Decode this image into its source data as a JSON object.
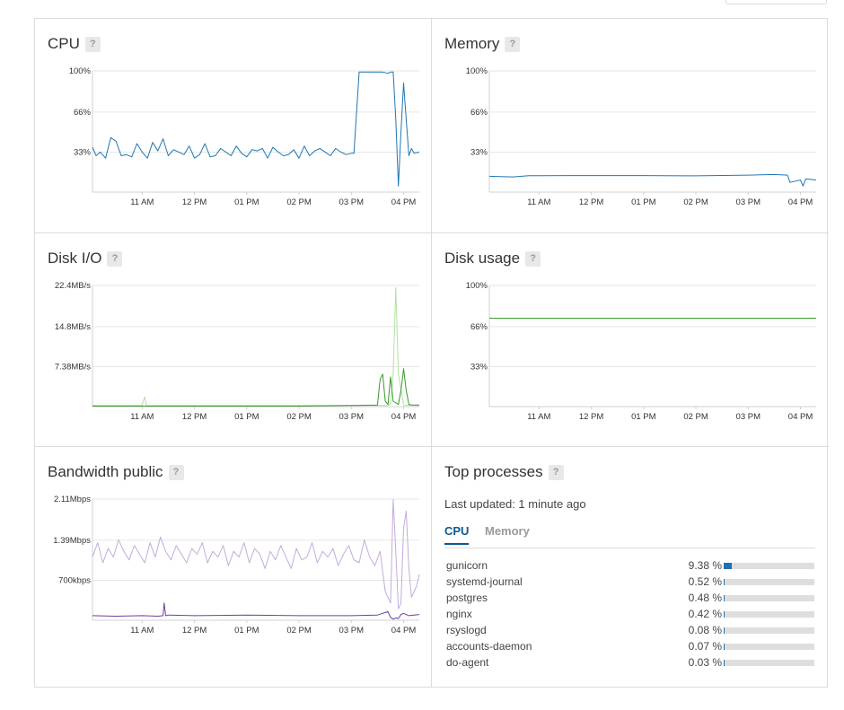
{
  "x_ticks": [
    "11 AM",
    "12 PM",
    "01 PM",
    "02 PM",
    "03 PM",
    "04 PM"
  ],
  "panels": {
    "cpu": {
      "title": "CPU",
      "help": "?",
      "chart_data": {
        "type": "line",
        "y_ticks": [
          "100%",
          "66%",
          "33%"
        ],
        "ylim": [
          0,
          100
        ],
        "xlim": [
          10.05,
          16.3
        ],
        "x_tick_values": [
          11,
          12,
          13,
          14,
          15,
          16
        ],
        "grid": true,
        "series": [
          {
            "color": "#1f77b4",
            "x": [
              10.05,
              10.12,
              10.2,
              10.3,
              10.4,
              10.5,
              10.6,
              10.7,
              10.8,
              10.9,
              11.0,
              11.1,
              11.2,
              11.3,
              11.4,
              11.5,
              11.6,
              11.7,
              11.8,
              11.9,
              12.0,
              12.1,
              12.2,
              12.3,
              12.4,
              12.5,
              12.6,
              12.7,
              12.8,
              12.9,
              13.0,
              13.1,
              13.2,
              13.3,
              13.4,
              13.5,
              13.6,
              13.7,
              13.8,
              13.9,
              14.0,
              14.1,
              14.2,
              14.3,
              14.4,
              14.5,
              14.6,
              14.7,
              14.8,
              14.9,
              15.0,
              15.05,
              15.15,
              15.3,
              15.45,
              15.6,
              15.7,
              15.75,
              15.8,
              15.85,
              15.9,
              15.95,
              16.0,
              16.05,
              16.1,
              16.15,
              16.2,
              16.3
            ],
            "y": [
              37,
              30,
              33,
              28,
              45,
              42,
              30,
              31,
              29,
              40,
              33,
              28,
              41,
              34,
              44,
              30,
              35,
              33,
              31,
              38,
              28,
              31,
              40,
              29,
              30,
              36,
              33,
              30,
              38,
              32,
              29,
              35,
              34,
              36,
              28,
              37,
              33,
              30,
              31,
              35,
              28,
              38,
              30,
              34,
              36,
              33,
              30,
              36,
              33,
              31,
              32,
              32,
              99,
              99,
              99,
              99,
              98,
              99,
              99,
              60,
              5,
              50,
              90,
              60,
              30,
              36,
              32,
              33
            ]
          }
        ]
      }
    },
    "memory": {
      "title": "Memory",
      "help": "?",
      "chart_data": {
        "type": "line",
        "y_ticks": [
          "100%",
          "66%",
          "33%"
        ],
        "ylim": [
          0,
          100
        ],
        "xlim": [
          10.05,
          16.3
        ],
        "x_tick_values": [
          11,
          12,
          13,
          14,
          15,
          16
        ],
        "grid": true,
        "series": [
          {
            "color": "#1f77b4",
            "x": [
              10.05,
              10.5,
              10.8,
              11.0,
              12.0,
              13.0,
              14.0,
              15.0,
              15.5,
              15.75,
              15.8,
              16.0,
              16.05,
              16.1,
              16.3
            ],
            "y": [
              13,
              12.5,
              13.5,
              13.5,
              13.6,
              13.6,
              13.4,
              14,
              14.5,
              14,
              8,
              10,
              5,
              11,
              10
            ]
          }
        ]
      }
    },
    "disk_io": {
      "title": "Disk I/O",
      "help": "?",
      "chart_data": {
        "type": "line",
        "y_ticks": [
          "22.4MB/s",
          "14.8MB/s",
          "7.38MB/s"
        ],
        "ylim": [
          0,
          22.4
        ],
        "xlim": [
          10.05,
          16.3
        ],
        "x_tick_values": [
          11,
          12,
          13,
          14,
          15,
          16
        ],
        "grid": true,
        "series": [
          {
            "color": "#b5e0a2",
            "x": [
              10.05,
              11.0,
              11.0,
              11.05,
              11.08,
              11.1,
              11.15,
              12.0,
              14.0,
              15.0,
              15.7,
              15.75,
              15.8,
              15.85,
              15.9,
              16.0,
              16.3
            ],
            "y": [
              0.2,
              0.2,
              0.3,
              1.8,
              0.3,
              0.2,
              0.2,
              0.2,
              0.2,
              0.2,
              0.2,
              0.5,
              6,
              22,
              6,
              0.3,
              0.2
            ]
          },
          {
            "color": "#3a9a2c",
            "x": [
              10.05,
              11.0,
              12.0,
              13.0,
              14.0,
              15.0,
              15.5,
              15.55,
              15.6,
              15.65,
              15.7,
              15.75,
              15.8,
              15.9,
              15.95,
              16.0,
              16.05,
              16.1,
              16.15,
              16.3
            ],
            "y": [
              0.1,
              0.1,
              0.1,
              0.1,
              0.1,
              0.2,
              0.3,
              5,
              6,
              1,
              0.4,
              5.5,
              1,
              0.4,
              3,
              7,
              3,
              0.4,
              0.3,
              0.3
            ]
          }
        ]
      }
    },
    "disk_usage": {
      "title": "Disk usage",
      "help": "?",
      "chart_data": {
        "type": "line",
        "y_ticks": [
          "100%",
          "66%",
          "33%"
        ],
        "ylim": [
          0,
          100
        ],
        "xlim": [
          10.05,
          16.3
        ],
        "x_tick_values": [
          11,
          12,
          13,
          14,
          15,
          16
        ],
        "grid": true,
        "series": [
          {
            "color": "#3a9a2c",
            "x": [
              10.05,
              16.3
            ],
            "y": [
              73,
              73
            ]
          }
        ]
      }
    },
    "bandwidth": {
      "title": "Bandwidth public",
      "help": "?",
      "chart_data": {
        "type": "line",
        "y_ticks": [
          "2.11Mbps",
          "1.39Mbps",
          "700kbps"
        ],
        "ylim": [
          0,
          2.11
        ],
        "xlim": [
          10.05,
          16.3
        ],
        "x_tick_values": [
          11,
          12,
          13,
          14,
          15,
          16
        ],
        "grid": true,
        "series": [
          {
            "color": "#c4abdb",
            "x": [
              10.05,
              10.15,
              10.25,
              10.35,
              10.45,
              10.55,
              10.65,
              10.75,
              10.85,
              10.95,
              11.05,
              11.15,
              11.25,
              11.35,
              11.45,
              11.55,
              11.65,
              11.75,
              11.85,
              11.95,
              12.05,
              12.15,
              12.25,
              12.35,
              12.45,
              12.55,
              12.65,
              12.75,
              12.85,
              12.95,
              13.05,
              13.15,
              13.25,
              13.35,
              13.45,
              13.55,
              13.65,
              13.75,
              13.85,
              13.95,
              14.05,
              14.15,
              14.25,
              14.35,
              14.45,
              14.55,
              14.65,
              14.75,
              14.85,
              14.95,
              15.05,
              15.15,
              15.25,
              15.35,
              15.45,
              15.55,
              15.65,
              15.75,
              15.8,
              15.85,
              15.9,
              15.95,
              16.0,
              16.05,
              16.1,
              16.15,
              16.2,
              16.25,
              16.3
            ],
            "y": [
              1.1,
              1.35,
              1.0,
              1.25,
              1.1,
              1.4,
              1.2,
              1.05,
              1.3,
              1.15,
              1.0,
              1.35,
              1.1,
              1.45,
              1.2,
              1.05,
              1.3,
              1.15,
              1.0,
              1.25,
              1.15,
              1.35,
              1.0,
              1.2,
              1.1,
              1.3,
              0.95,
              1.2,
              1.1,
              1.35,
              1.0,
              1.25,
              1.15,
              0.9,
              1.2,
              1.05,
              1.3,
              1.1,
              0.9,
              1.25,
              1.05,
              1.1,
              1.35,
              1.0,
              1.2,
              1.1,
              1.25,
              0.95,
              1.15,
              1.3,
              1.05,
              1.0,
              1.4,
              1.1,
              0.95,
              1.2,
              0.5,
              0.3,
              2.1,
              1.2,
              0.2,
              0.3,
              1.6,
              1.9,
              0.9,
              0.4,
              0.5,
              0.6,
              0.8
            ]
          },
          {
            "color": "#6b3fa0",
            "x": [
              10.05,
              10.5,
              11.0,
              11.3,
              11.4,
              11.42,
              11.45,
              11.5,
              12.0,
              13.0,
              14.0,
              15.0,
              15.5,
              15.7,
              15.75,
              15.8,
              15.85,
              15.9,
              15.95,
              16.0,
              16.1,
              16.2,
              16.3
            ],
            "y": [
              0.08,
              0.07,
              0.08,
              0.07,
              0.08,
              0.3,
              0.08,
              0.09,
              0.08,
              0.09,
              0.08,
              0.08,
              0.09,
              0.15,
              0.05,
              0.02,
              0.04,
              0.03,
              0.1,
              0.12,
              0.08,
              0.09,
              0.1
            ]
          }
        ]
      }
    },
    "top_processes": {
      "title": "Top processes",
      "help": "?",
      "last_updated": "Last updated: 1 minute ago",
      "tabs": [
        "CPU",
        "Memory"
      ],
      "active_tab": "CPU",
      "accent": "#1e70b5",
      "processes": [
        {
          "name": "gunicorn",
          "value": "9.38 %",
          "pct": 9.38
        },
        {
          "name": "systemd-journal",
          "value": "0.52 %",
          "pct": 0.52
        },
        {
          "name": "postgres",
          "value": "0.48 %",
          "pct": 0.48
        },
        {
          "name": "nginx",
          "value": "0.42 %",
          "pct": 0.42
        },
        {
          "name": "rsyslogd",
          "value": "0.08 %",
          "pct": 0.08
        },
        {
          "name": "accounts-daemon",
          "value": "0.07 %",
          "pct": 0.07
        },
        {
          "name": "do-agent",
          "value": "0.03 %",
          "pct": 0.03
        }
      ]
    }
  }
}
